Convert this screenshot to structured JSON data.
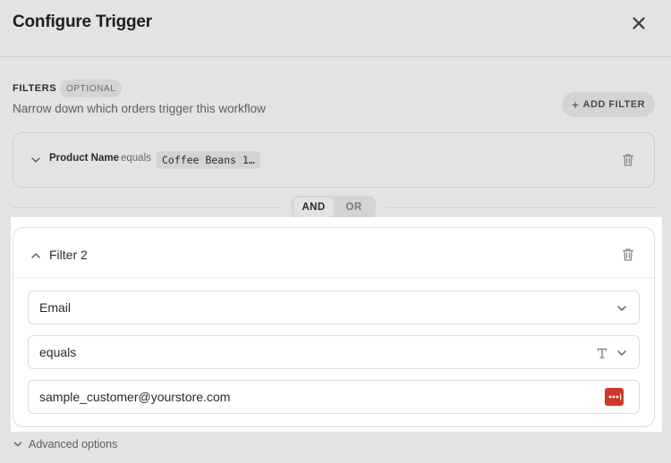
{
  "header": {
    "title": "Configure Trigger"
  },
  "filters": {
    "label": "FILTERS",
    "badge": "OPTIONAL",
    "description": "Narrow down which orders trigger this workflow",
    "add_button": "ADD FILTER",
    "add_icon": "+"
  },
  "filter1": {
    "field": "Product Name",
    "operator": "equals",
    "value": "Coffee Beans 1…"
  },
  "logic": {
    "and": "AND",
    "or": "OR",
    "selected": "AND"
  },
  "filter2": {
    "title": "Filter 2",
    "field_select": "Email",
    "operator_select": "equals",
    "value_input": "sample_customer@yourstore.com"
  },
  "advanced": {
    "label": "Advanced options"
  },
  "colors": {
    "password_manager": "#d0382b"
  }
}
